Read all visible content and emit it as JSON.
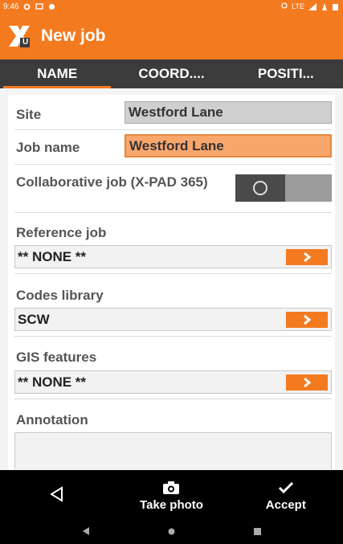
{
  "status_bar": {
    "time": "9:46",
    "right_text": "LTE",
    "icons": [
      "settings-icon",
      "message-icon",
      "notification-icon",
      "wifi-icon",
      "signal-icon",
      "battery-icon"
    ]
  },
  "app_bar": {
    "title": "New job",
    "logo_letter": "U"
  },
  "tabs": [
    {
      "label": "NAME",
      "active": true
    },
    {
      "label": "COORD...."
    },
    {
      "label": "POSITI..."
    }
  ],
  "form": {
    "site": {
      "label": "Site",
      "value": "Westford Lane"
    },
    "job_name": {
      "label": "Job name",
      "value": "Westford Lane"
    },
    "collaborative": {
      "label": "Collaborative job (X-PAD 365)",
      "state": "off"
    },
    "reference_job": {
      "label": "Reference job",
      "value": "** NONE **"
    },
    "codes_library": {
      "label": "Codes library",
      "value": "SCW"
    },
    "gis_features": {
      "label": "GIS features",
      "value": "** NONE **"
    },
    "annotation": {
      "label": "Annotation",
      "value": ""
    }
  },
  "bottom_bar": {
    "back_icon": "back-triangle-icon",
    "take_photo": "Take photo",
    "accept": "Accept"
  },
  "colors": {
    "accent": "#f47a20",
    "dark": "#3b3b3b"
  }
}
